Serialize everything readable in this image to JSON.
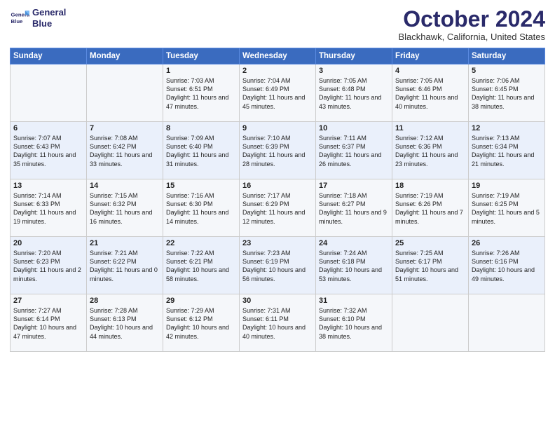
{
  "header": {
    "logo_line1": "General",
    "logo_line2": "Blue",
    "month": "October 2024",
    "location": "Blackhawk, California, United States"
  },
  "days_of_week": [
    "Sunday",
    "Monday",
    "Tuesday",
    "Wednesday",
    "Thursday",
    "Friday",
    "Saturday"
  ],
  "weeks": [
    [
      {
        "day": "",
        "info": ""
      },
      {
        "day": "",
        "info": ""
      },
      {
        "day": "1",
        "info": "Sunrise: 7:03 AM\nSunset: 6:51 PM\nDaylight: 11 hours and 47 minutes."
      },
      {
        "day": "2",
        "info": "Sunrise: 7:04 AM\nSunset: 6:49 PM\nDaylight: 11 hours and 45 minutes."
      },
      {
        "day": "3",
        "info": "Sunrise: 7:05 AM\nSunset: 6:48 PM\nDaylight: 11 hours and 43 minutes."
      },
      {
        "day": "4",
        "info": "Sunrise: 7:05 AM\nSunset: 6:46 PM\nDaylight: 11 hours and 40 minutes."
      },
      {
        "day": "5",
        "info": "Sunrise: 7:06 AM\nSunset: 6:45 PM\nDaylight: 11 hours and 38 minutes."
      }
    ],
    [
      {
        "day": "6",
        "info": "Sunrise: 7:07 AM\nSunset: 6:43 PM\nDaylight: 11 hours and 35 minutes."
      },
      {
        "day": "7",
        "info": "Sunrise: 7:08 AM\nSunset: 6:42 PM\nDaylight: 11 hours and 33 minutes."
      },
      {
        "day": "8",
        "info": "Sunrise: 7:09 AM\nSunset: 6:40 PM\nDaylight: 11 hours and 31 minutes."
      },
      {
        "day": "9",
        "info": "Sunrise: 7:10 AM\nSunset: 6:39 PM\nDaylight: 11 hours and 28 minutes."
      },
      {
        "day": "10",
        "info": "Sunrise: 7:11 AM\nSunset: 6:37 PM\nDaylight: 11 hours and 26 minutes."
      },
      {
        "day": "11",
        "info": "Sunrise: 7:12 AM\nSunset: 6:36 PM\nDaylight: 11 hours and 23 minutes."
      },
      {
        "day": "12",
        "info": "Sunrise: 7:13 AM\nSunset: 6:34 PM\nDaylight: 11 hours and 21 minutes."
      }
    ],
    [
      {
        "day": "13",
        "info": "Sunrise: 7:14 AM\nSunset: 6:33 PM\nDaylight: 11 hours and 19 minutes."
      },
      {
        "day": "14",
        "info": "Sunrise: 7:15 AM\nSunset: 6:32 PM\nDaylight: 11 hours and 16 minutes."
      },
      {
        "day": "15",
        "info": "Sunrise: 7:16 AM\nSunset: 6:30 PM\nDaylight: 11 hours and 14 minutes."
      },
      {
        "day": "16",
        "info": "Sunrise: 7:17 AM\nSunset: 6:29 PM\nDaylight: 11 hours and 12 minutes."
      },
      {
        "day": "17",
        "info": "Sunrise: 7:18 AM\nSunset: 6:27 PM\nDaylight: 11 hours and 9 minutes."
      },
      {
        "day": "18",
        "info": "Sunrise: 7:19 AM\nSunset: 6:26 PM\nDaylight: 11 hours and 7 minutes."
      },
      {
        "day": "19",
        "info": "Sunrise: 7:19 AM\nSunset: 6:25 PM\nDaylight: 11 hours and 5 minutes."
      }
    ],
    [
      {
        "day": "20",
        "info": "Sunrise: 7:20 AM\nSunset: 6:23 PM\nDaylight: 11 hours and 2 minutes."
      },
      {
        "day": "21",
        "info": "Sunrise: 7:21 AM\nSunset: 6:22 PM\nDaylight: 11 hours and 0 minutes."
      },
      {
        "day": "22",
        "info": "Sunrise: 7:22 AM\nSunset: 6:21 PM\nDaylight: 10 hours and 58 minutes."
      },
      {
        "day": "23",
        "info": "Sunrise: 7:23 AM\nSunset: 6:19 PM\nDaylight: 10 hours and 56 minutes."
      },
      {
        "day": "24",
        "info": "Sunrise: 7:24 AM\nSunset: 6:18 PM\nDaylight: 10 hours and 53 minutes."
      },
      {
        "day": "25",
        "info": "Sunrise: 7:25 AM\nSunset: 6:17 PM\nDaylight: 10 hours and 51 minutes."
      },
      {
        "day": "26",
        "info": "Sunrise: 7:26 AM\nSunset: 6:16 PM\nDaylight: 10 hours and 49 minutes."
      }
    ],
    [
      {
        "day": "27",
        "info": "Sunrise: 7:27 AM\nSunset: 6:14 PM\nDaylight: 10 hours and 47 minutes."
      },
      {
        "day": "28",
        "info": "Sunrise: 7:28 AM\nSunset: 6:13 PM\nDaylight: 10 hours and 44 minutes."
      },
      {
        "day": "29",
        "info": "Sunrise: 7:29 AM\nSunset: 6:12 PM\nDaylight: 10 hours and 42 minutes."
      },
      {
        "day": "30",
        "info": "Sunrise: 7:31 AM\nSunset: 6:11 PM\nDaylight: 10 hours and 40 minutes."
      },
      {
        "day": "31",
        "info": "Sunrise: 7:32 AM\nSunset: 6:10 PM\nDaylight: 10 hours and 38 minutes."
      },
      {
        "day": "",
        "info": ""
      },
      {
        "day": "",
        "info": ""
      }
    ]
  ]
}
